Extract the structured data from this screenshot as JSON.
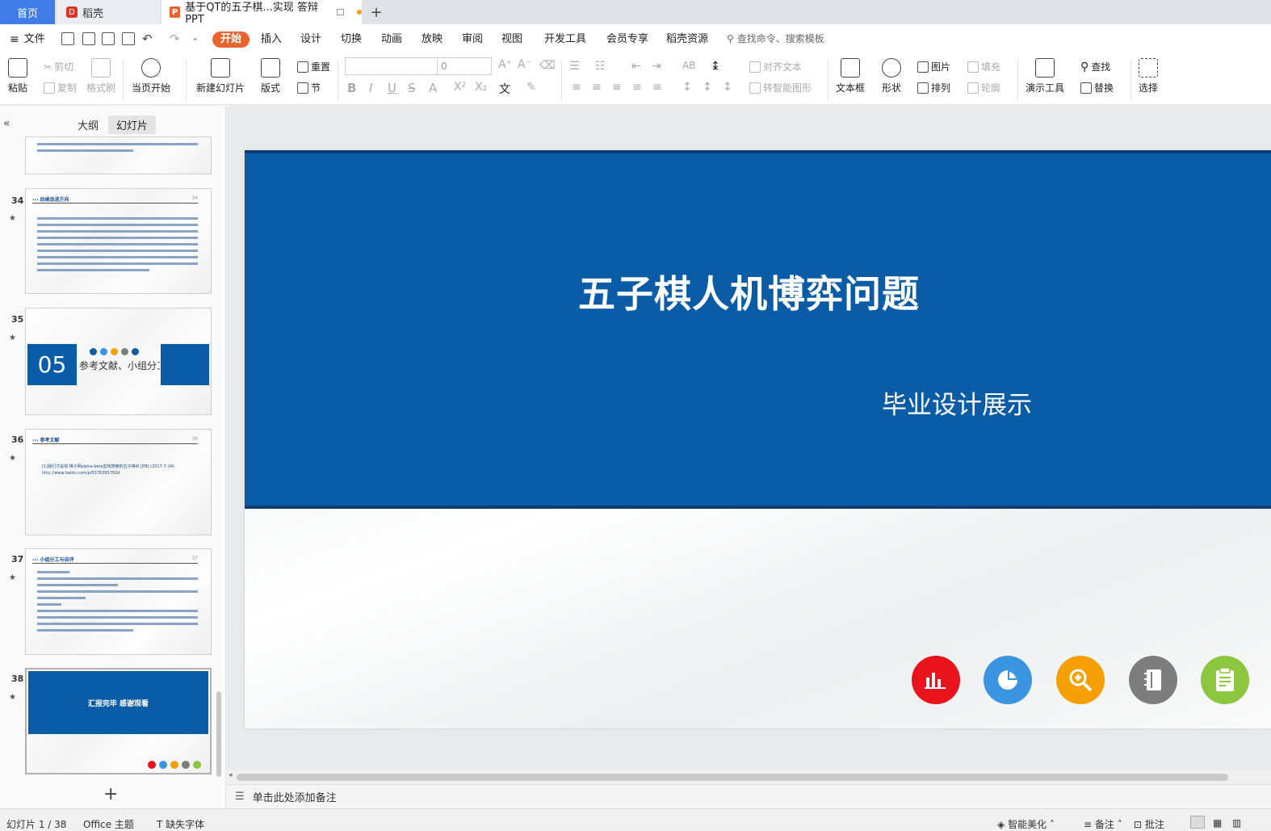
{
  "tabs": {
    "home": "首页",
    "daoke": "稻壳",
    "document": "基于QT的五子棋...实现 答辩PPT",
    "add": "+"
  },
  "menu": {
    "file": "文件",
    "items": [
      "开始",
      "插入",
      "设计",
      "切换",
      "动画",
      "放映",
      "审阅",
      "视图",
      "开发工具",
      "会员专享",
      "稻壳资源"
    ],
    "search": "查找命令、搜索模板"
  },
  "ribbon": {
    "paste": "粘贴",
    "cut": "剪切",
    "copy": "复制",
    "format_painter": "格式刷",
    "from_current": "当页开始",
    "new_slide": "新建幻灯片",
    "layout": "版式",
    "reset": "重置",
    "section": "节",
    "font_size": "0",
    "align_text": "对齐文本",
    "smart_art": "转智能图形",
    "textbox": "文本框",
    "shape": "形状",
    "picture": "图片",
    "arrange": "排列",
    "fill": "填充",
    "outline": "轮廓",
    "present_tools": "演示工具",
    "find": "查找",
    "replace": "替换",
    "select": "选择"
  },
  "panel": {
    "outline_tab": "大纲",
    "slides_tab": "幻灯片",
    "thumbs": [
      {
        "num": "34",
        "title": "后续改进方向",
        "page": "34"
      },
      {
        "num": "35",
        "section_num": "05",
        "section_text": "参考文献、小组分工"
      },
      {
        "num": "36",
        "title": "参考文献",
        "page": "36",
        "ref": "[1]我们才是快 棋子网alpha-beta剪枝搜索的五子棋AI [EB] (2017-7-14) http://www.baidu.com/p/5376395782d"
      },
      {
        "num": "37",
        "title": "小组分工与自评",
        "page": "37"
      },
      {
        "num": "38",
        "end_text": "汇报完毕 感谢观看"
      }
    ],
    "star": "★"
  },
  "slide": {
    "title": "五子棋人机博弈问题",
    "subtitle": "毕业设计展示",
    "colors": {
      "band": "#0a5ca6",
      "circle_red": "#e8131b",
      "circle_blue": "#3a94e0",
      "circle_orange": "#f5a000",
      "circle_gray": "#7d7d7d",
      "circle_green": "#8cc63f"
    }
  },
  "notes": {
    "placeholder": "单击此处添加备注"
  },
  "status": {
    "slide_count": "幻灯片 1 / 38",
    "theme": "Office 主题",
    "missing_font": "缺失字体",
    "beautify": "智能美化",
    "notes": "备注",
    "comments": "批注"
  }
}
